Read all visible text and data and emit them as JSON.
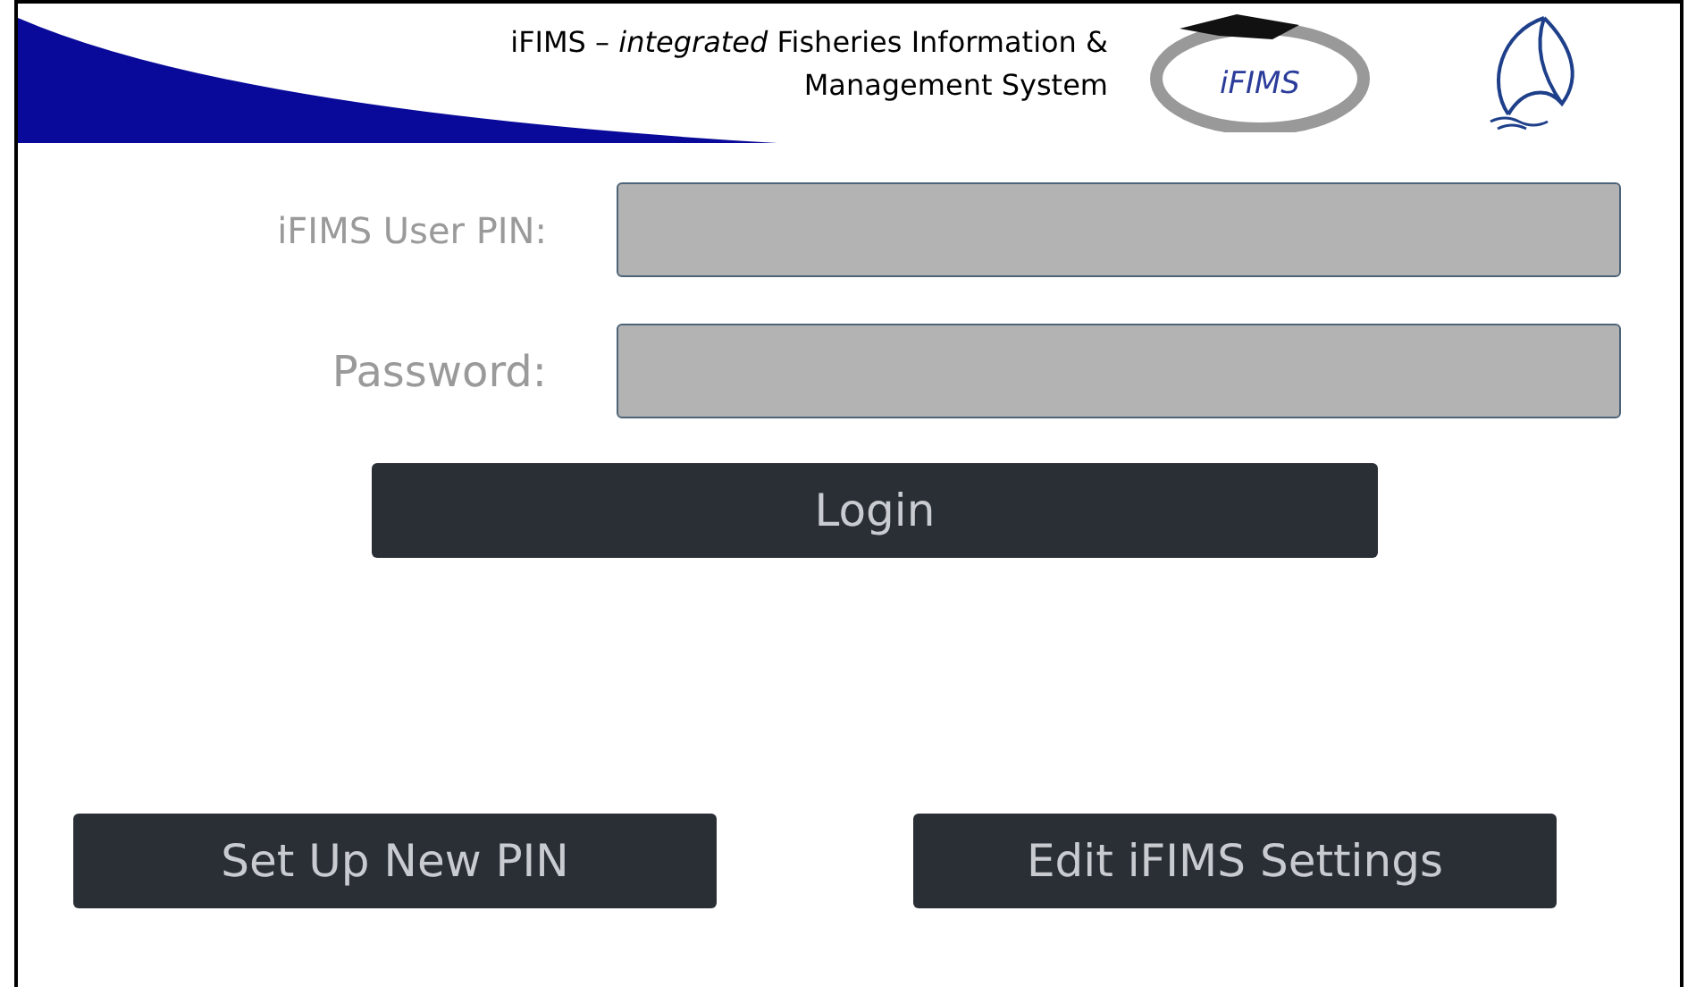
{
  "header": {
    "title_lines": [
      "iFIMS – *integrated* Fisheries Information &",
      "Management System"
    ],
    "logo_text": "iFIMS"
  },
  "fields": [
    {
      "label": "iFIMS User PIN:"
    },
    {
      "label": "Password:"
    }
  ],
  "login_button": "Login",
  "bottom_buttons": [
    "Set Up New PIN",
    "Edit iFIMS Settings"
  ]
}
